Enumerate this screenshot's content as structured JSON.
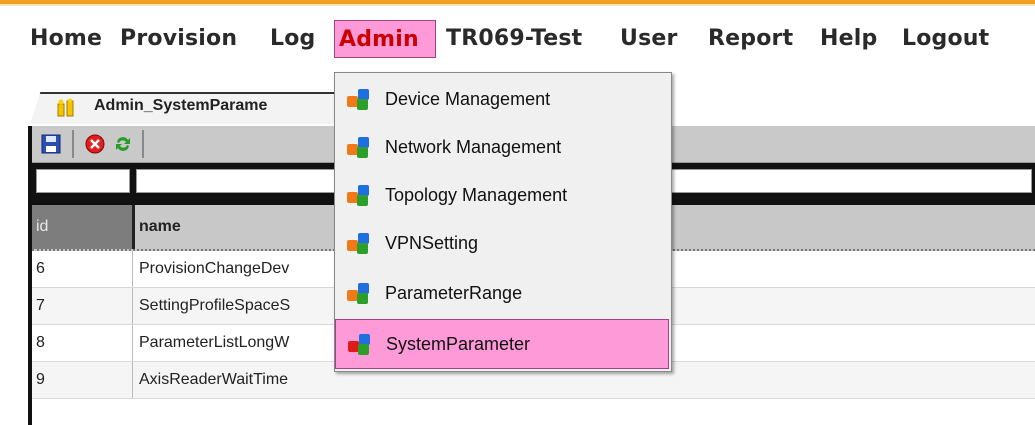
{
  "menubar": {
    "items": [
      {
        "label": "Home"
      },
      {
        "label": "Provision"
      },
      {
        "label": "Log"
      },
      {
        "label": "Admin",
        "active": true
      },
      {
        "label": "TR069-Test"
      },
      {
        "label": "User"
      },
      {
        "label": "Report"
      },
      {
        "label": "Help"
      },
      {
        "label": "Logout"
      }
    ]
  },
  "window": {
    "tab_title": "Admin_SystemParame"
  },
  "toolbar": {
    "icons": [
      "save-icon",
      "cancel-icon",
      "refresh-icon"
    ]
  },
  "table": {
    "columns": [
      "id",
      "name"
    ],
    "rows": [
      {
        "id": "6",
        "name": "ProvisionChangeDev"
      },
      {
        "id": "7",
        "name": "SettingProfileSpaceS"
      },
      {
        "id": "8",
        "name": "ParameterListLongW"
      },
      {
        "id": "9",
        "name": "AxisReaderWaitTime"
      }
    ]
  },
  "admin_menu": {
    "items": [
      {
        "label": "Device Management"
      },
      {
        "label": "Network Management"
      },
      {
        "label": "Topology Management"
      },
      {
        "label": "VPNSetting"
      },
      {
        "label": "ParameterRange"
      },
      {
        "label": "SystemParameter",
        "active": true
      }
    ]
  },
  "colors": {
    "accent_orange": "#f0a020",
    "menu_active_bg": "#ff9ad8",
    "menu_active_text": "#cc0000"
  }
}
